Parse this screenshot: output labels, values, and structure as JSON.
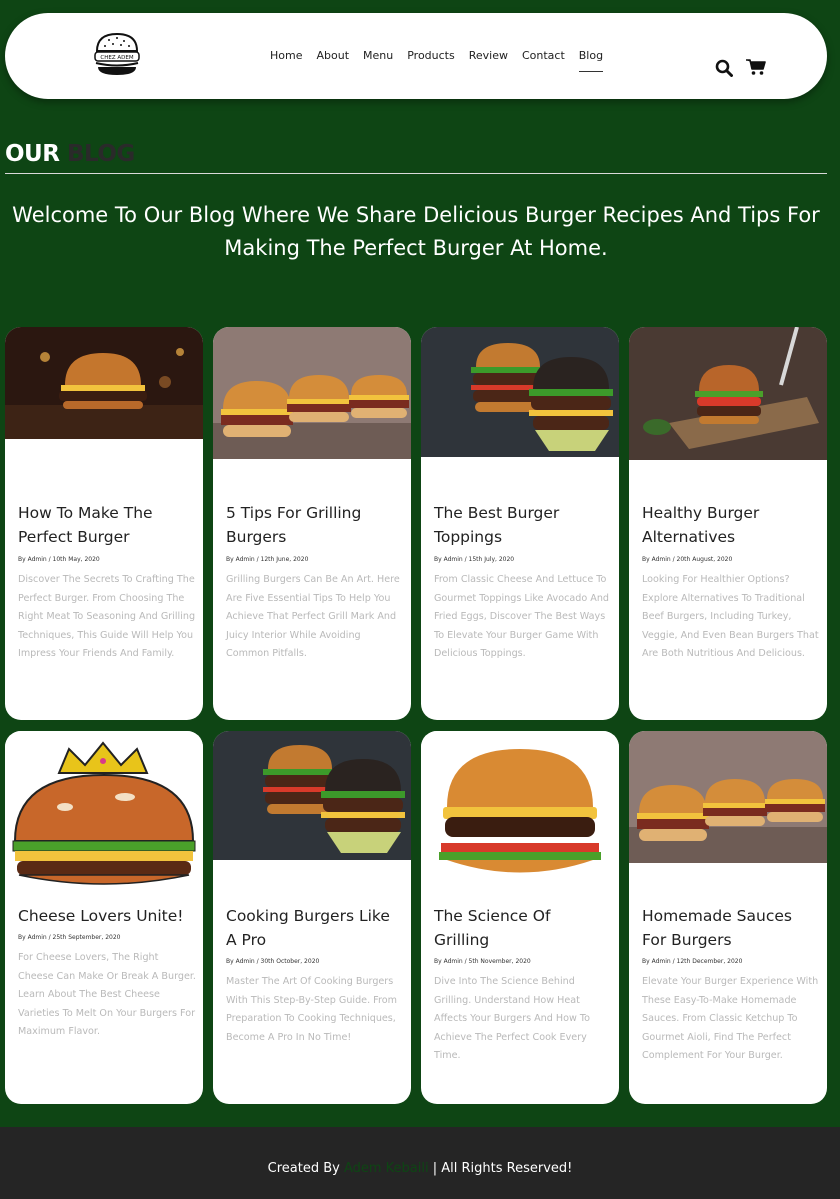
{
  "header": {
    "logo_text": "CHEZ ADEM",
    "nav": [
      {
        "label": "Home"
      },
      {
        "label": "About"
      },
      {
        "label": "Menu"
      },
      {
        "label": "Products"
      },
      {
        "label": "Review"
      },
      {
        "label": "Contact"
      },
      {
        "label": "Blog",
        "active": true
      }
    ],
    "icons": [
      "search-icon",
      "cart-icon"
    ]
  },
  "blog": {
    "heading_word1": "OUR",
    "heading_word2": "BLOG",
    "intro": "Welcome To Our Blog Where We Share Delicious Burger Recipes And Tips For Making The Perfect Burger At Home."
  },
  "posts": [
    {
      "title": "How To Make The Perfect Burger",
      "meta": "By Admin / 10th May, 2020",
      "excerpt": "Discover The Secrets To Crafting The Perfect Burger. From Choosing The Right Meat To Seasoning And Grilling Techniques, This Guide Will Help You Impress Your Friends And Family."
    },
    {
      "title": "5 Tips For Grilling Burgers",
      "meta": "By Admin / 12th June, 2020",
      "excerpt": "Grilling Burgers Can Be An Art. Here Are Five Essential Tips To Help You Achieve That Perfect Grill Mark And Juicy Interior While Avoiding Common Pitfalls."
    },
    {
      "title": "The Best Burger Toppings",
      "meta": "By Admin / 15th July, 2020",
      "excerpt": "From Classic Cheese And Lettuce To Gourmet Toppings Like Avocado And Fried Eggs, Discover The Best Ways To Elevate Your Burger Game With Delicious Toppings."
    },
    {
      "title": "Healthy Burger Alternatives",
      "meta": "By Admin / 20th August, 2020",
      "excerpt": "Looking For Healthier Options? Explore Alternatives To Traditional Beef Burgers, Including Turkey, Veggie, And Even Bean Burgers That Are Both Nutritious And Delicious."
    },
    {
      "title": "Cheese Lovers Unite!",
      "meta": "By Admin / 25th September, 2020",
      "excerpt": "For Cheese Lovers, The Right Cheese Can Make Or Break A Burger. Learn About The Best Cheese Varieties To Melt On Your Burgers For Maximum Flavor."
    },
    {
      "title": "Cooking Burgers Like A Pro",
      "meta": "By Admin / 30th October, 2020",
      "excerpt": "Master The Art Of Cooking Burgers With This Step-By-Step Guide. From Preparation To Cooking Techniques, Become A Pro In No Time!"
    },
    {
      "title": "The Science Of Grilling",
      "meta": "By Admin / 5th November, 2020",
      "excerpt": "Dive Into The Science Behind Grilling. Understand How Heat Affects Your Burgers And How To Achieve The Perfect Cook Every Time."
    },
    {
      "title": "Homemade Sauces For Burgers",
      "meta": "By Admin / 12th December, 2020",
      "excerpt": "Elevate Your Burger Experience With These Easy-To-Make Homemade Sauces. From Classic Ketchup To Gourmet Aioli, Find The Perfect Complement For Your Burger."
    }
  ],
  "footer": {
    "prefix": "Created By",
    "author": "Adem Kebaili",
    "suffix": "| All Rights Reserved!"
  },
  "colors": {
    "page_background": "#0e4514",
    "footer_background": "#252525",
    "excerpt_text": "#b9b9b9"
  }
}
